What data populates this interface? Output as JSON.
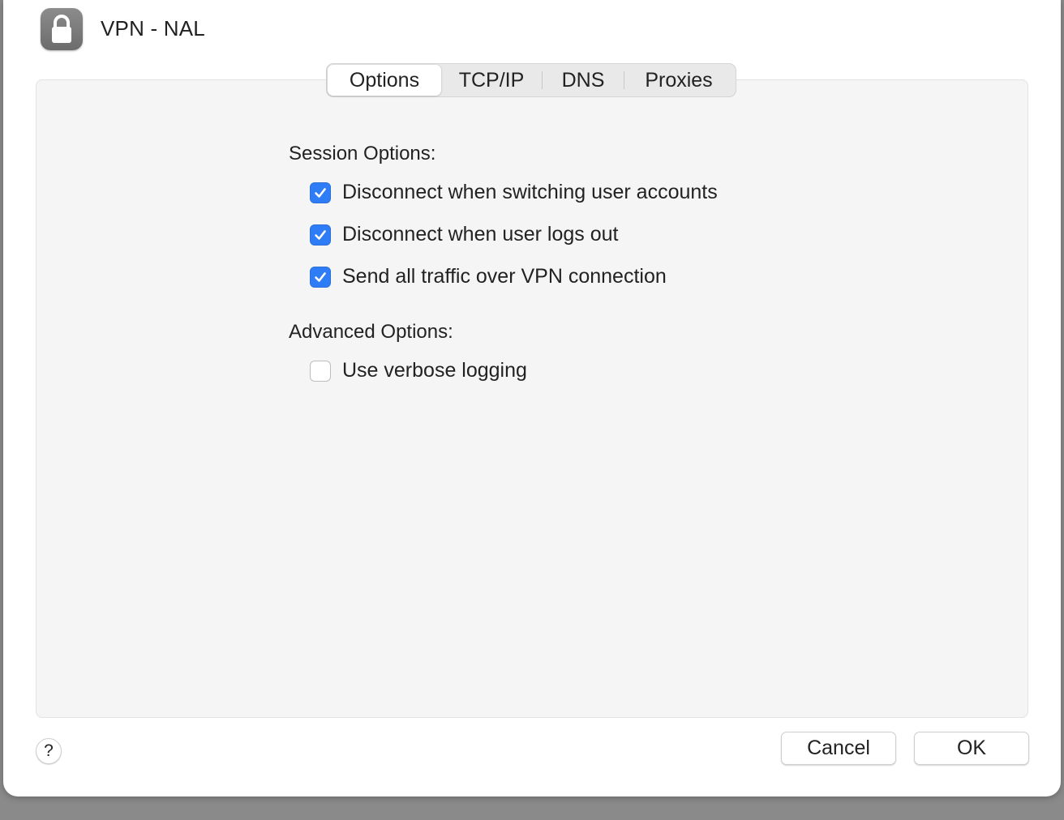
{
  "header": {
    "title": "VPN - NAL",
    "icon": "lock-icon"
  },
  "tabs": [
    {
      "label": "Options",
      "active": true
    },
    {
      "label": "TCP/IP",
      "active": false
    },
    {
      "label": "DNS",
      "active": false
    },
    {
      "label": "Proxies",
      "active": false
    }
  ],
  "session": {
    "heading": "Session Options:",
    "items": [
      {
        "label": "Disconnect when switching user accounts",
        "checked": true
      },
      {
        "label": "Disconnect when user logs out",
        "checked": true
      },
      {
        "label": "Send all traffic over VPN connection",
        "checked": true
      }
    ]
  },
  "advanced": {
    "heading": "Advanced Options:",
    "items": [
      {
        "label": "Use verbose logging",
        "checked": false
      }
    ]
  },
  "footer": {
    "help_label": "?",
    "cancel_label": "Cancel",
    "ok_label": "OK"
  },
  "colors": {
    "accent": "#2e7cf6",
    "panel": "#f5f5f5"
  }
}
